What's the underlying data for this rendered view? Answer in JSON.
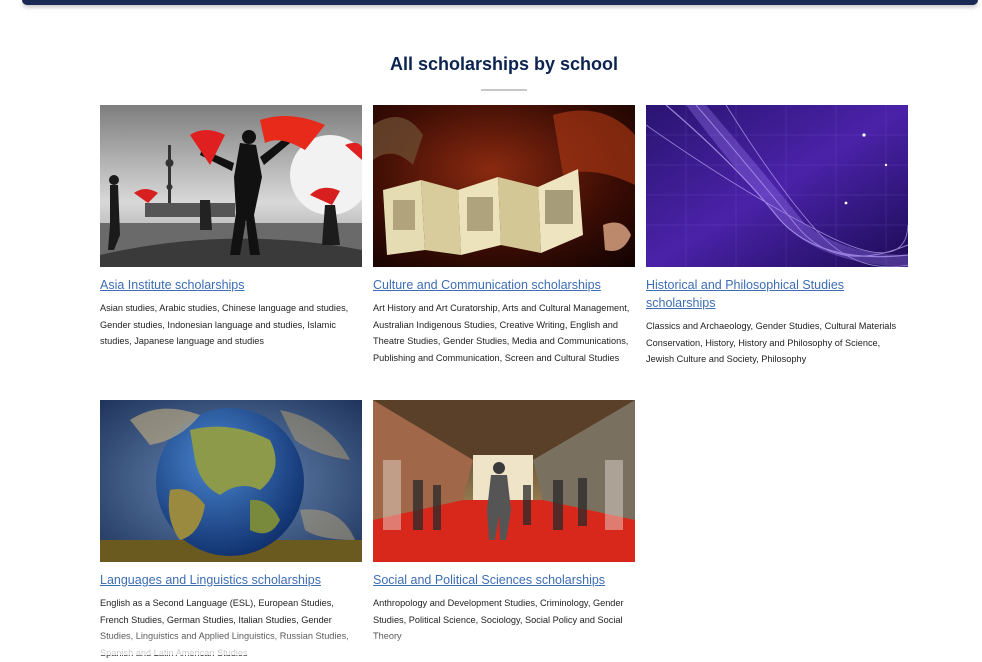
{
  "page": {
    "title": "All scholarships by school"
  },
  "cards": [
    {
      "image_name": "tai-chi-fans-skyline-image",
      "title": "Asia Institute scholarships",
      "description": "Asian studies, Arabic studies, Chinese language and studies, Gender studies, Indonesian language and studies, Islamic studies, Japanese language and studies"
    },
    {
      "image_name": "ancient-manuscript-image",
      "title": "Culture and Communication scholarships",
      "description": "Art History and Art Curatorship, Arts and Cultural Management, Australian Indigenous Studies, Creative Writing, English and Theatre Studies, Gender Studies, Media and Communications, Publishing and Communication, Screen and Cultural Studies"
    },
    {
      "image_name": "purple-abstract-lines-image",
      "title": "Historical and Philosophical Studies scholarships",
      "description": "Classics and Archaeology, Gender Studies, Cultural Materials Conservation, History, History and Philosophy of Science, Jewish Culture and Society, Philosophy"
    },
    {
      "image_name": "globe-image",
      "title": "Languages and Linguistics scholarships",
      "description": "English as a Second Language (ESL), European Studies, French Studies, German Studies, Italian Studies, Gender Studies, Linguistics and Applied Linguistics, Russian Studies, Spanish and Latin American Studies"
    },
    {
      "image_name": "crowd-motion-blur-image",
      "title": "Social and Political Sciences scholarships",
      "description": "Anthropology and Development Studies, Criminology, Gender Studies, Political Science, Sociology, Social Policy and Social Theory"
    }
  ]
}
